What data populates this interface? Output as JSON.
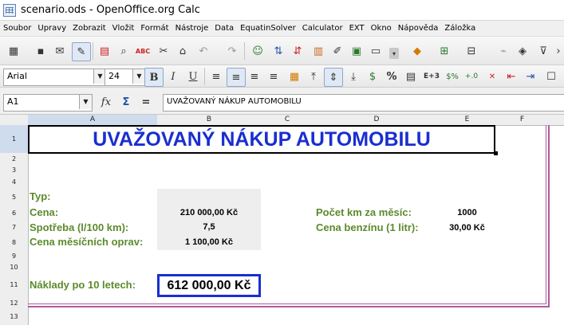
{
  "window": {
    "title": "scenario.ods - OpenOffice.org Calc"
  },
  "menu": [
    "Soubor",
    "Upravy",
    "Zobrazit",
    "Vložit",
    "Formát",
    "Nástroje",
    "Data",
    "EquatinSolver",
    "Calculator",
    "EXT",
    "Okno",
    "Nápověda",
    "Záložka"
  ],
  "format_toolbar": {
    "font_name": "Arial",
    "font_size": "24",
    "number_text": "E+3"
  },
  "formula_bar": {
    "cell_ref": "A1",
    "content": "UVAŽOVANÝ NÁKUP AUTOMOBILU"
  },
  "columns": [
    "A",
    "B",
    "C",
    "D",
    "E",
    "F"
  ],
  "rows": [
    "1",
    "2",
    "3",
    "4",
    "5",
    "6",
    "7",
    "8",
    "9",
    "10",
    "11",
    "12",
    "13"
  ],
  "sheet": {
    "title": "UVAŽOVANÝ NÁKUP AUTOMOBILU",
    "typ_label": "Typ:",
    "cena_label": "Cena:",
    "cena_value": "210 000,00 Kč",
    "spotreba_label": "Spotřeba (l/100 km):",
    "spotreba_value": "7,5",
    "opravy_label": "Cena měsíčních oprav:",
    "opravy_value": "1 100,00 Kč",
    "km_label": "Počet km za měsíc:",
    "km_value": "1000",
    "benzin_label": "Cena benzínu (1 litr):",
    "benzin_value": "30,00 Kč",
    "naklady_label": "Náklady po 10 letech:",
    "naklady_value": "612 000,00 Kč"
  },
  "colors": {
    "title_blue": "#1a2ed0",
    "label_green": "#5c8a2c",
    "border_purple": "#b05aa0"
  }
}
